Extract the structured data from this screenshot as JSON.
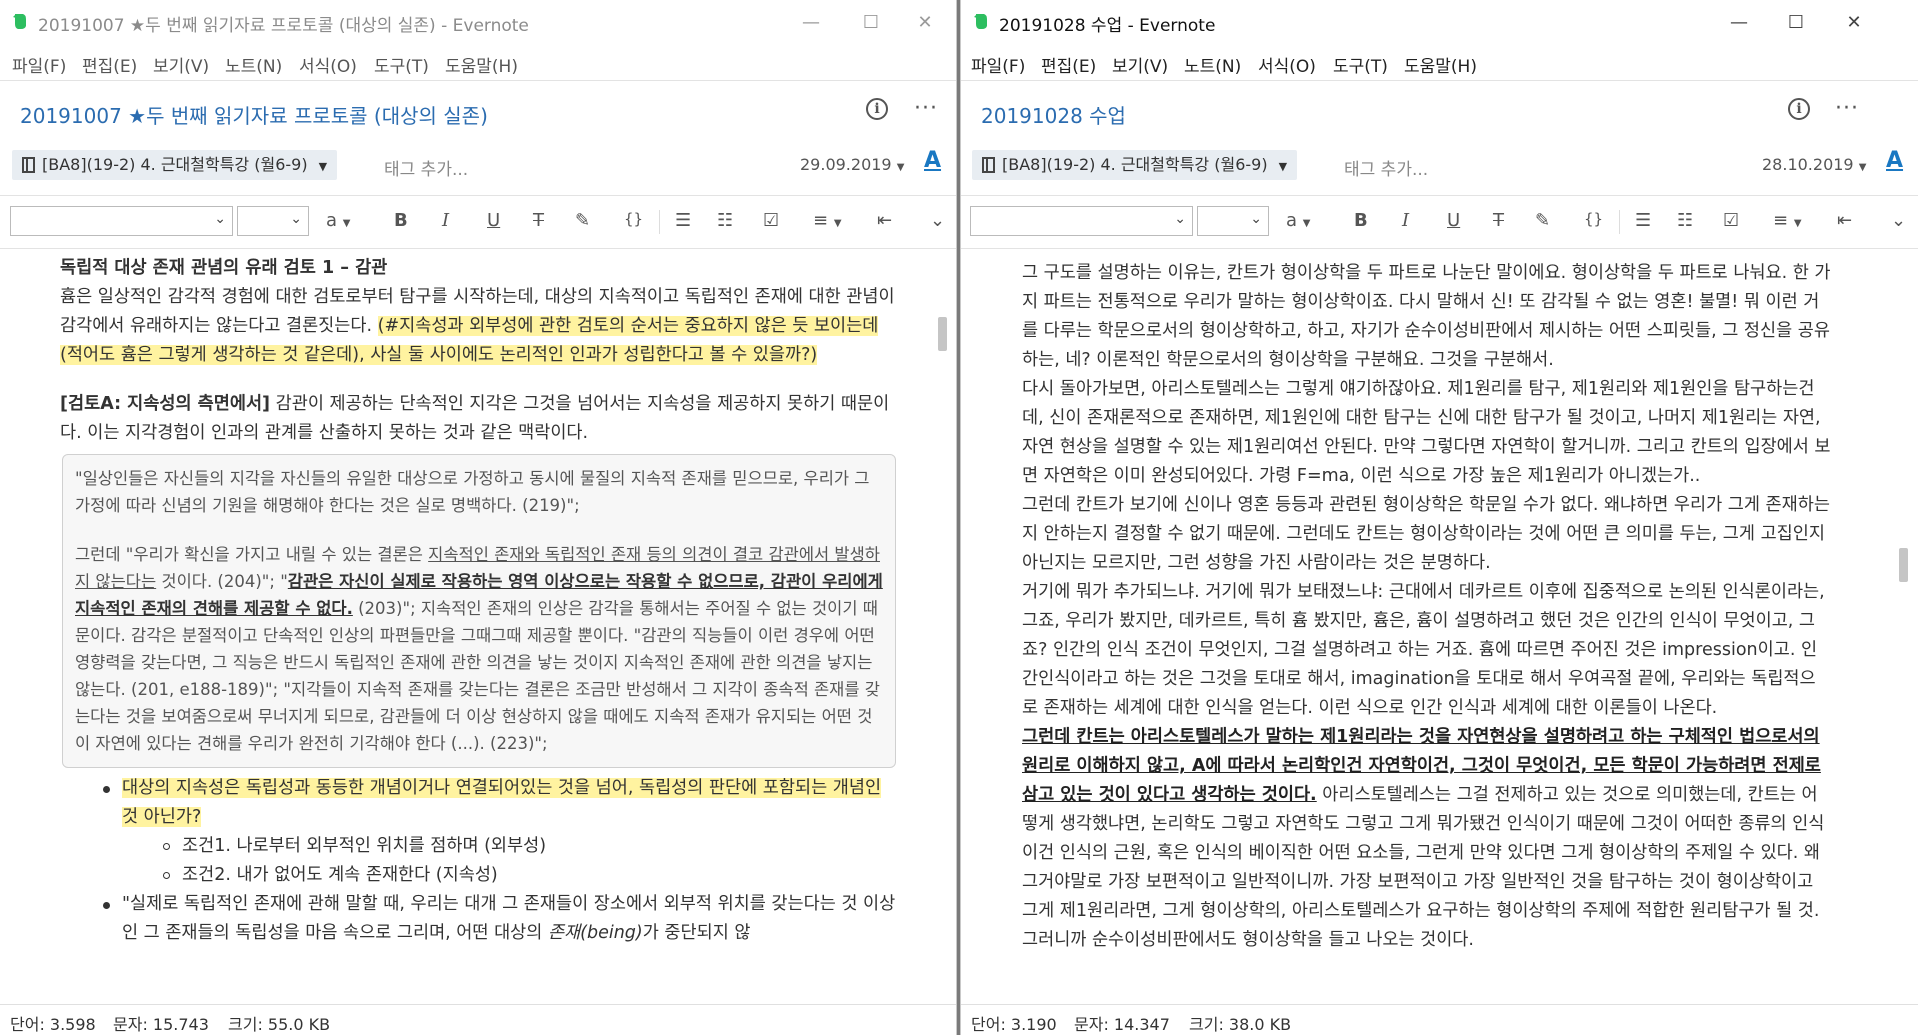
{
  "left": {
    "window_title": "20191007 ★두 번째 읽기자료 프로토콜 (대상의 실존) - Evernote",
    "menu": [
      "파일(F)",
      "편집(E)",
      "보기(V)",
      "노트(N)",
      "서식(O)",
      "도구(T)",
      "도움말(H)"
    ],
    "note_title": "20191007 ★두 번째 읽기자료 프로토콜 (대상의 실존)",
    "notebook": "[BA8](19-2) 4. 근대철학특강 (월6-9)",
    "tag_placeholder": "태그 추가...",
    "date": "29.09.2019",
    "font_button": "A",
    "heading": "독립적 대상 존재 관념의 유래 검토 1 – 감관",
    "para1_plain": "흄은 일상적인 감각적 경험에 대한 검토로부터 탐구를 시작하는데, 대상의 지속적이고 독립적인 존재에 대한 관념이 감각에서 유래하지는 않는다고 결론짓는다. ",
    "para1_highlight": "(#지속성과 외부성에 관한 검토의 순서는 중요하지 않은 듯 보이는데(적어도 흄은 그렇게 생각하는 것 같은데), 사실 둘 사이에도 논리적인 인과가 성립한다고 볼 수 있을까?)",
    "para2_bold": "[검토A: 지속성의 측면에서]",
    "para2_plain": " 감관이 제공하는 단속적인 지각은 그것을 넘어서는 지속성을 제공하지 못하기 때문이다. 이는 지각경험이 인과의 관계를 산출하지 못하는 것과 같은 맥락이다.",
    "quote1": "\"일상인들은 자신들의 지각을 자신들의 유일한 대상으로 가정하고 동시에 물질의 지속적 존재를 믿으므로, 우리가 그 가정에 따라 신념의 기원을 해명해야 한다는 것은 실로 명백하다. (219)\";",
    "quote2_a": "그런데 \"우리가 확신을 가지고 내릴 수 있는 결론은 ",
    "quote2_underline": "지속적인 존재와 독립적인 존재 등의 의견이 결코 감관에서 발생하지 않는다는",
    "quote2_b": " 것이다. (204)\"; \"",
    "quote2_bold": "감관은 자신이 실제로 작용하는 영역 이상으로는 작용할 수 없으므로, 감관이 우리에게 지속적인 존재의 견해를 제공할 수 없다.",
    "quote2_c": " (203)\"; 지속적인 존재의 인상은 감각을 통해서는 주어질 수 없는 것이기 때문이다. 감각은 분절적이고 단속적인 인상의 파편들만을 그때그때 제공할 뿐이다. \"감관의 직능들이 이런 경우에 어떤 영향력을 갖는다면, 그 직능은 반드시 독립적인 존재에 관한 의견을 낳는 것이지 지속적인 존재에 관한 의견을 낳지는 않는다. (201, e188-189)\"; \"지각들이 지속적 존재를 갖는다는 결론은 조금만 반성해서 그 지각이 종속적 존재를 갖는다는 것을 보여줌으로써 무너지게 되므로, 감관들에 더 이상 현상하지 않을 때에도 지속적 존재가 유지되는 어떤 것이 자연에 있다는 견해를 우리가 완전히 기각해야 한다 (...). (223)\";",
    "bullet1": "대상의 지속성은 독립성과 동등한 개념이거나 연결되어있는 것을 넘어, 독립성의 판단에 포함되는 개념인 것 아닌가?",
    "sub1": "조건1. 나로부터 외부적인 위치를 점하며 (외부성)",
    "sub2": "조건2. 내가 없어도 계속 존재한다 (지속성)",
    "bullet2_a": "\"실제로 독립적인 존재에 관해 말할 때, 우리는 대개 그 존재들이 장소에서 외부적 위치를 갖는다는 것 이상인 그 존재들의 독립성을 마음 속으로 그리며, 어떤 대상의 ",
    "bullet2_italic": "존재(being)",
    "bullet2_b": "가 중단되지 않",
    "status": {
      "words": "단어: 3.598",
      "chars": "문자: 15.743",
      "size": "크기: 55.0 KB"
    }
  },
  "right": {
    "window_title": "20191028 수업 - Evernote",
    "menu": [
      "파일(F)",
      "편집(E)",
      "보기(V)",
      "노트(N)",
      "서식(O)",
      "도구(T)",
      "도움말(H)"
    ],
    "note_title": "20191028 수업",
    "notebook": "[BA8](19-2) 4. 근대철학특강 (월6-9)",
    "tag_placeholder": "태그 추가...",
    "date": "28.10.2019",
    "font_button": "A",
    "p1": "그 구도를 설명하는 이유는, 칸트가 형이상학을 두 파트로 나눈단 말이에요. 형이상학을 두 파트로 나눠요. 한 가지 파트는 전통적으로 우리가 말하는 형이상학이죠. 다시 말해서 신! 또 감각될 수 없는 영혼! 불멸! 뭐 이런 거를 다루는 학문으로서의 형이상학하고, 하고, 자기가 순수이성비판에서 제시하는 어떤 스피릿들, 그 정신을 공유하는, 네? 이론적인 학문으로서의 형이상학을 구분해요. 그것을 구분해서.",
    "p2": "다시 돌아가보면, 아리스토텔레스는 그렇게 얘기하잖아요. 제1원리를 탐구, 제1원리와 제1원인을 탐구하는건데, 신이 존재론적으로 존재하면, 제1원인에 대한 탐구는 신에 대한 탐구가 될 것이고, 나머지 제1원리는 자연, 자연 현상을 설명할 수 있는 제1원리여선 안된다. 만약 그렇다면 자연학이 할거니까. 그리고 칸트의 입장에서 보면 자연학은 이미 완성되어있다. 가령 F=ma, 이런 식으로 가장 높은 제1원리가 아니겠는가..",
    "p3": "그런데 칸트가 보기에 신이나 영혼 등등과 관련된 형이상학은 학문일 수가 없다. 왜냐하면 우리가 그게 존재하는지 안하는지 결정할 수 없기 때문에. 그런데도 칸트는 형이상학이라는 것에 어떤 큰 의미를 두는, 그게 고집인지 아닌지는 모르지만, 그런 성향을 가진 사람이라는 것은 분명하다.",
    "p4": "거기에 뭐가 추가되느냐. 거기에 뭐가 보태졌느냐: 근대에서 데카르트 이후에 집중적으로 논의된 인식론이라는, 그죠, 우리가 봤지만, 데카르트, 특히 흄 봤지만, 흄은, 흄이 설명하려고 했던 것은 인간의 인식이 무엇이고, 그죠? 인간의 인식 조건이 무엇인지, 그걸 설명하려고 하는 거죠. 흄에 따르면 주어진 것은 impression이고. 인간인식이라고 하는 것은 그것을 토대로 해서, imagination을 토대로 해서 우여곡절 끝에, 우리와는 독립적으로 존재하는 세계에 대한 인식을 얻는다. 이런 식으로 인간 인식과 세계에 대한 이론들이 나온다.",
    "p5_bold": "그런데 칸트는 아리스토텔레스가 말하는 제1원리라는 것을 자연현상을 설명하려고 하는 구체적인 법으로서의 원리로 이해하지 않고, A에 따라서 논리학인건 자연학이건, 그것이 무엇이건, 모든 학문이 가능하려면 전제로 삼고 있는 것이 있다고 생각하는 것이다.",
    "p5_plain": " 아리스토텔레스는 그걸 전제하고 있는 것으로 의미했는데, 칸트는 어떻게 생각했냐면, 논리학도 그렇고 자연학도 그렇고 그게 뭐가됐건 인식이기 때문에 그것이 어떠한 종류의 인식이건 인식의 근원, 혹은 인식의 베이직한 어떤 요소들, 그런게 만약 있다면 그게 형이상학의 주제일 수 있다. 왜 그거야말로 가장 보편적이고 일반적이니까. 가장 보편적이고 가장 일반적인 것을 탐구하는 것이 형이상학이고 그게 제1원리라면, 그게 형이상학의, 아리스토텔레스가 요구하는 형이상학의 주제에 적합한 원리탐구가 될 것. 그러니까 순수이성비판에서도 형이상학을 들고 나오는 것이다.",
    "status": {
      "words": "단어: 3.190",
      "chars": "문자: 14.347",
      "size": "크기: 38.0 KB"
    }
  },
  "window_controls": {
    "minimize": "—",
    "maximize": "☐",
    "close": "✕"
  },
  "toolbar_glyphs": {
    "highlight": "a",
    "bold": "B",
    "italic": "I",
    "underline": "U",
    "strike": "T",
    "code": "{}",
    "more": "⌄"
  },
  "colors": {
    "accent": "#2b6cb0",
    "highlight": "#fff3a0",
    "logo": "#2dbe60"
  }
}
